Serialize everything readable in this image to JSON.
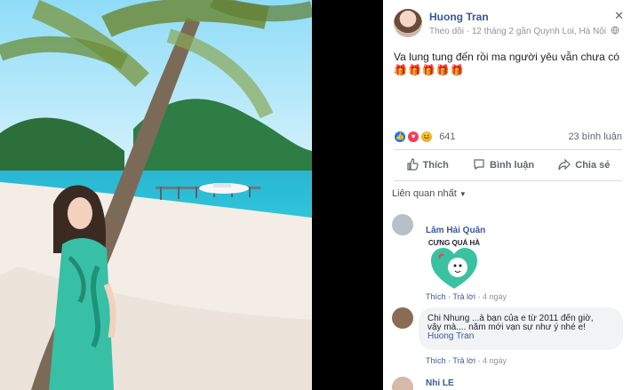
{
  "post": {
    "author": "Huong Tran",
    "follow": "Theo dõi",
    "time_location": "12 tháng 2 gần Quynh Loi, Hà Nội",
    "text": "Va lung tung đến rồi ma người yêu vẫn chưa có ...",
    "emoji_row": "🎁🎁🎁🎁🎁",
    "reactions_count": "641",
    "comments_count": "23 bình luận"
  },
  "actions": {
    "like": "Thích",
    "comment": "Bình luận",
    "share": "Chia sẻ"
  },
  "sort_label": "Liên quan nhất",
  "comments": [
    {
      "name": "Lâm Hải Quân",
      "sticker_text": "CƯNG QUÁ HÀ",
      "like": "Thích",
      "reply": "Trả lời",
      "time": "4 ngày"
    },
    {
      "text": "Chi Nhung ...à bạn của e từ 2011 đến giờ,",
      "text2": "vậy mà.... năm mới vạn sự như ý nhé e!",
      "mention": "Huong Tran",
      "like": "Thích",
      "reply": "Trả lời",
      "time": "4 ngày"
    },
    {
      "name": "Nhi LE"
    }
  ],
  "colors": {
    "link": "#385898",
    "meta": "#90949c",
    "divider": "#dadde1",
    "bubble": "#f2f3f5",
    "sea": "#2bb9d6",
    "sand": "#f6efe7"
  },
  "icons": [
    "close-icon",
    "globe-icon",
    "like-icon",
    "comment-icon",
    "share-icon",
    "dropdown-icon"
  ]
}
